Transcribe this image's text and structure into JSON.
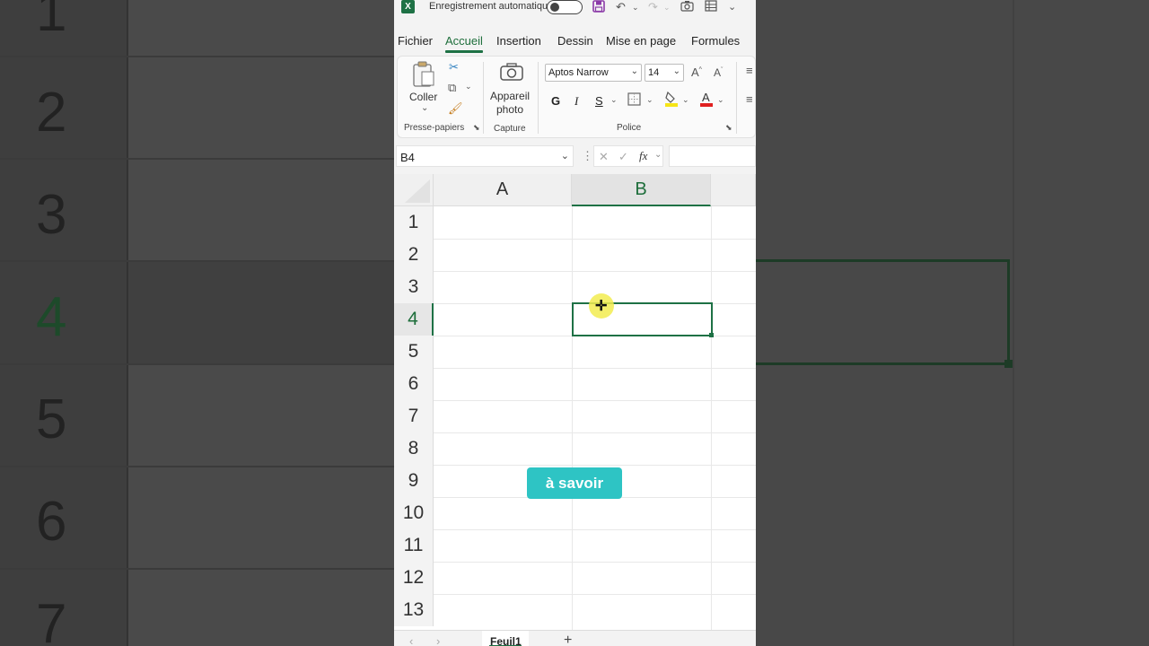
{
  "titlebar": {
    "app_icon": "excel-logo",
    "autosave_label": "Enregistrement automatique",
    "autosave_on": false
  },
  "tabs": [
    {
      "label": "Fichier",
      "active": false
    },
    {
      "label": "Accueil",
      "active": true
    },
    {
      "label": "Insertion",
      "active": false
    },
    {
      "label": "Dessin",
      "active": false
    },
    {
      "label": "Mise en page",
      "active": false
    },
    {
      "label": "Formules",
      "active": false
    }
  ],
  "ribbon": {
    "clipboard": {
      "paste_label": "Coller",
      "group_label": "Presse-papiers"
    },
    "capture": {
      "camera_label_1": "Appareil",
      "camera_label_2": "photo",
      "group_label": "Capture"
    },
    "font": {
      "font_name": "Aptos Narrow",
      "font_size": "14",
      "bold": "G",
      "italic": "I",
      "underline": "S",
      "group_label": "Police",
      "fill_color": "#f6e516",
      "font_color": "#e02020"
    }
  },
  "formula_bar": {
    "name_box": "B4",
    "fx": "fx",
    "formula": ""
  },
  "grid": {
    "columns": [
      {
        "label": "A",
        "selected": false
      },
      {
        "label": "B",
        "selected": true
      }
    ],
    "rows": [
      "1",
      "2",
      "3",
      "4",
      "5",
      "6",
      "7",
      "8",
      "9",
      "10",
      "11",
      "12",
      "13"
    ],
    "selected_row": "4",
    "selected_cell": "B4"
  },
  "overlay_badge": "à savoir",
  "sheets": {
    "active": "Feuil1",
    "add_label": "+"
  },
  "background_zoom": {
    "row_numbers": [
      "1",
      "2",
      "3",
      "4",
      "5",
      "6",
      "7"
    ]
  },
  "colors": {
    "accent": "#1e7145",
    "badge": "#2ec4c4",
    "cursor_highlight": "#f2ec50"
  }
}
